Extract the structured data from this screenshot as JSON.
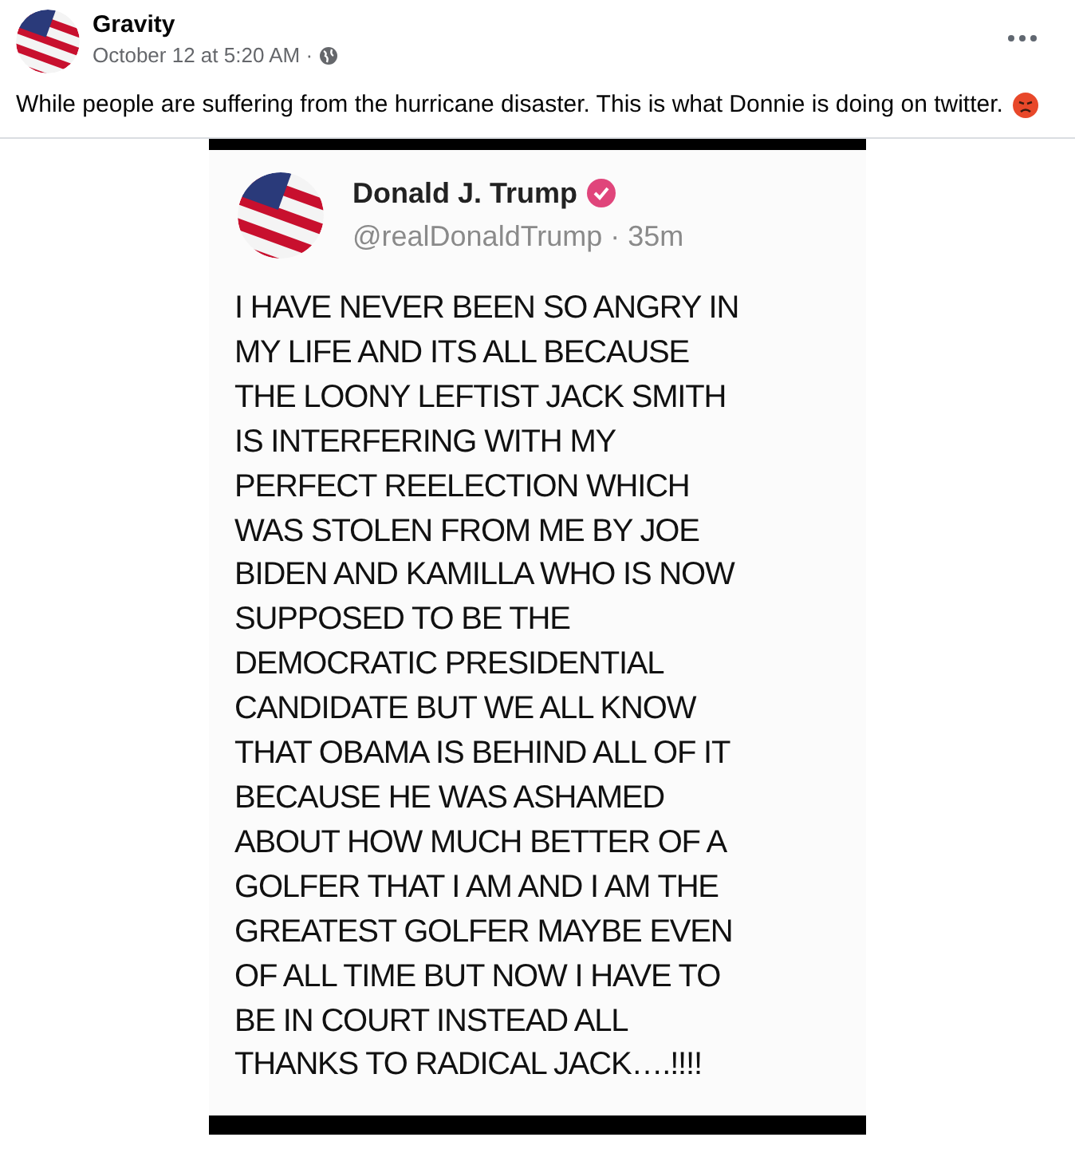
{
  "post": {
    "author": "Gravity",
    "timestamp": "October 12 at 5:20 AM ·",
    "text": "While people are suffering from the hurricane disaster. This is what Donnie is doing on twitter."
  },
  "tweet": {
    "name": "Donald J. Trump",
    "verified": true,
    "handle": "@realDonaldTrump · 35m",
    "lines": [
      "I HAVE NEVER BEEN SO ANGRY IN",
      "MY LIFE AND ITS ALL BECAUSE",
      "THE LOONY LEFTIST JACK SMITH",
      "IS INTERFERING WITH MY",
      "PERFECT REELECTION WHICH",
      "WAS STOLEN FROM ME BY JOE",
      "BIDEN AND KAMILLA WHO IS NOW",
      "SUPPOSED TO BE THE",
      "DEMOCRATIC PRESIDENTIAL",
      "CANDIDATE BUT WE ALL KNOW",
      "THAT OBAMA IS BEHIND ALL OF IT",
      "BECAUSE HE WAS ASHAMED",
      "ABOUT HOW MUCH BETTER OF A",
      "GOLFER THAT I AM AND I AM THE",
      "GREATEST GOLFER MAYBE EVEN",
      "OF ALL TIME BUT NOW I HAVE TO",
      "BE IN COURT INSTEAD ALL",
      "THANKS TO RADICAL JACK….!!!!"
    ]
  }
}
